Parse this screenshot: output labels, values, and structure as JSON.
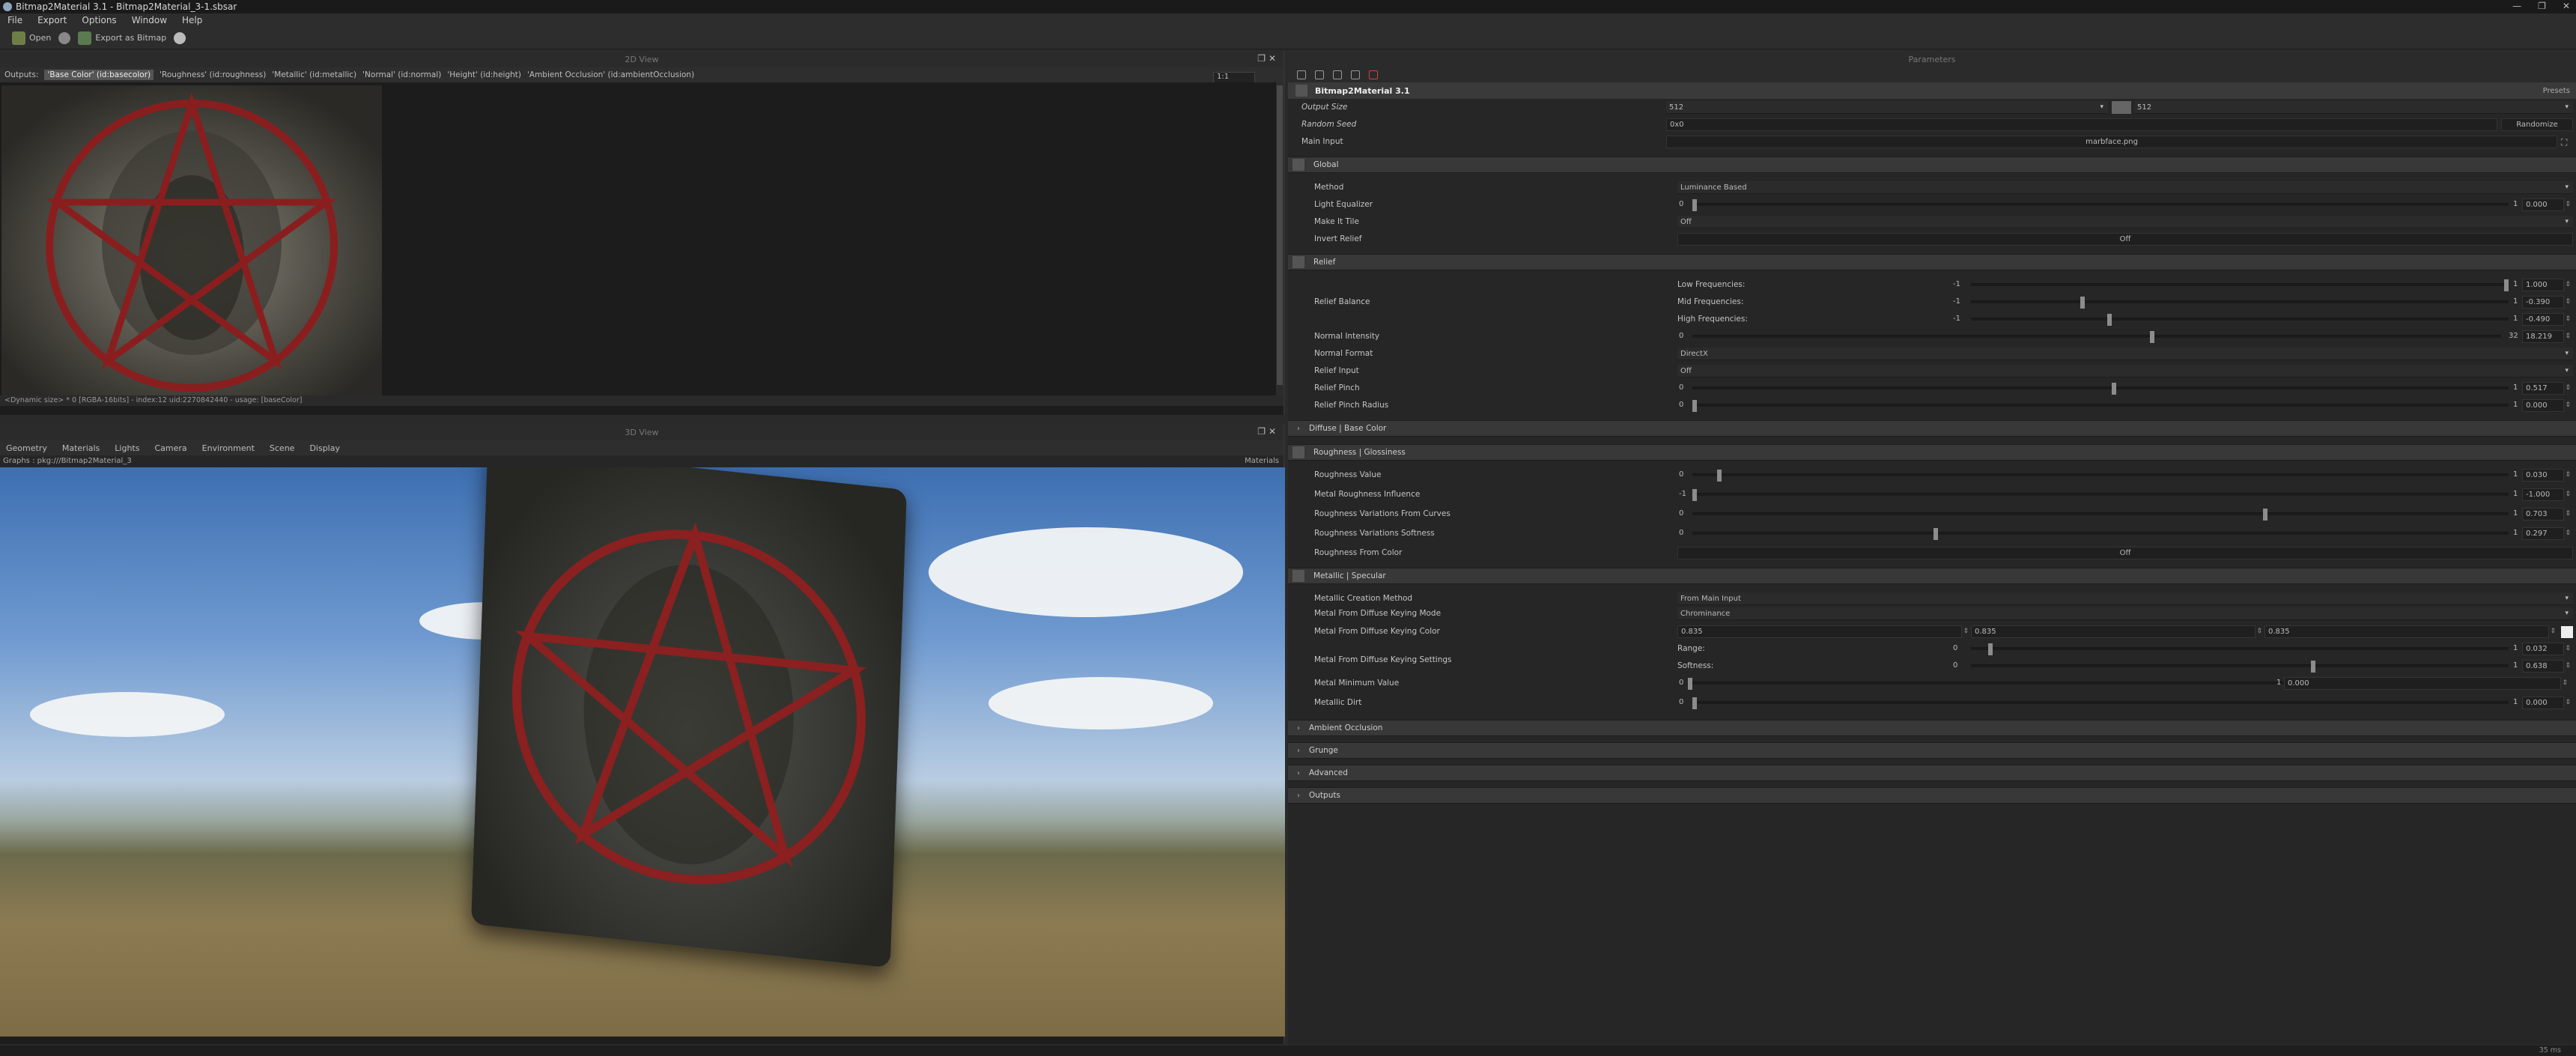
{
  "window": {
    "title": "Bitmap2Material 3.1 - Bitmap2Material_3-1.sbsar",
    "controls": [
      "—",
      "❐",
      "✕"
    ]
  },
  "menu": [
    "File",
    "Export",
    "Options",
    "Window",
    "Help"
  ],
  "toolbar": {
    "open": "Open",
    "export_bitmap": "Export as Bitmap"
  },
  "view2d": {
    "header": "2D View",
    "outputs_label": "Outputs:",
    "outputs": [
      {
        "label": "'Base Color' (id:basecolor)",
        "selected": true
      },
      {
        "label": "'Roughness' (id:roughness)",
        "selected": false
      },
      {
        "label": "'Metallic' (id:metallic)",
        "selected": false
      },
      {
        "label": "'Normal' (id:normal)",
        "selected": false
      },
      {
        "label": "'Height' (id:height)",
        "selected": false
      },
      {
        "label": "'Ambient Occlusion' (id:ambientOcclusion)",
        "selected": false
      }
    ],
    "zoom": "1:1",
    "info": "<Dynamic size> * 0 [RGBA-16bits] - index:12 uid:2270842440 - usage: [baseColor]"
  },
  "view3d": {
    "header": "3D View",
    "tabs": [
      "Geometry",
      "Materials",
      "Lights",
      "Camera",
      "Environment",
      "Scene",
      "Display"
    ],
    "graph": "Graphs : pkg:///Bitmap2Material_3",
    "material": "Materials"
  },
  "params": {
    "header": "Parameters",
    "graph_title": "Bitmap2Material 3.1",
    "presets": "Presets",
    "output_size": {
      "label": "Output Size",
      "w": "512",
      "h": "512"
    },
    "random_seed": {
      "label": "Random Seed",
      "value": "0x0",
      "button": "Randomize"
    },
    "main_input": {
      "label": "Main Input",
      "value": "marbface.png"
    },
    "global": {
      "title": "Global",
      "method": {
        "label": "Method",
        "value": "Luminance Based"
      },
      "light_equalizer": {
        "label": "Light Equalizer",
        "min": "0",
        "max": "1",
        "value": "0.000",
        "pos": 0.0
      },
      "make_it_tile": {
        "label": "Make It Tile",
        "value": "Off"
      },
      "invert_relief": {
        "label": "Invert Relief",
        "value": "Off"
      }
    },
    "relief": {
      "title": "Relief",
      "balance_label": "Relief Balance",
      "low": {
        "label": "Low Frequencies:",
        "min": "-1",
        "max": "1",
        "value": "1.000",
        "pos": 1.0
      },
      "mid": {
        "label": "Mid Frequencies:",
        "min": "-1",
        "max": "1",
        "value": "-0.390",
        "pos": 0.205
      },
      "high": {
        "label": "High Frequencies:",
        "min": "-1",
        "max": "1",
        "value": "-0.490",
        "pos": 0.255
      },
      "normal_intensity": {
        "label": "Normal Intensity",
        "min": "0",
        "max": "32",
        "value": "18.219",
        "pos": 0.569
      },
      "normal_format": {
        "label": "Normal Format",
        "value": "DirectX"
      },
      "relief_input": {
        "label": "Relief Input",
        "value": "Off"
      },
      "relief_pinch": {
        "label": "Relief Pinch",
        "min": "0",
        "max": "1",
        "value": "0.517",
        "pos": 0.517
      },
      "relief_pinch_radius": {
        "label": "Relief Pinch Radius",
        "min": "0",
        "max": "1",
        "value": "0.000",
        "pos": 0.0
      }
    },
    "diffuse": {
      "title": "Diffuse | Base Color"
    },
    "roughness": {
      "title": "Roughness | Glossiness",
      "value": {
        "label": "Roughness Value",
        "min": "0",
        "max": "1",
        "value": "0.030",
        "pos": 0.03
      },
      "metal_influence": {
        "label": "Metal Roughness Influence",
        "min": "-1",
        "max": "1",
        "value": "-1.000",
        "pos": 0.0
      },
      "variations_curves": {
        "label": "Roughness Variations From Curves",
        "min": "0",
        "max": "1",
        "value": "0.703",
        "pos": 0.703
      },
      "variations_softness": {
        "label": "Roughness Variations Softness",
        "min": "0",
        "max": "1",
        "value": "0.297",
        "pos": 0.297
      },
      "from_color": {
        "label": "Roughness From Color",
        "value": "Off"
      }
    },
    "metallic": {
      "title": "Metallic | Specular",
      "creation_method": {
        "label": "Metallic Creation Method",
        "value": "From Main Input"
      },
      "keying_mode": {
        "label": "Metal From Diffuse Keying Mode",
        "value": "Chrominance"
      },
      "keying_color": {
        "label": "Metal From Diffuse Keying Color",
        "r": "0.835",
        "g": "0.835",
        "b": "0.835"
      },
      "keying_settings_label": "Metal From Diffuse Keying Settings",
      "range": {
        "label": "Range:",
        "min": "0",
        "max": "1",
        "value": "0.032",
        "pos": 0.032
      },
      "softness": {
        "label": "Softness:",
        "min": "0",
        "max": "1",
        "value": "0.638",
        "pos": 0.638
      },
      "min_value": {
        "label": "Metal Minimum Value",
        "min": "0",
        "max": "1",
        "value": "0.000",
        "pos": 0.0
      },
      "dirt": {
        "label": "Metallic Dirt",
        "min": "0",
        "max": "1",
        "value": "0.000",
        "pos": 0.0
      }
    },
    "collapsed": [
      "Ambient Occlusion",
      "Grunge",
      "Advanced",
      "Outputs"
    ]
  },
  "status": {
    "ms": "35 ms"
  }
}
